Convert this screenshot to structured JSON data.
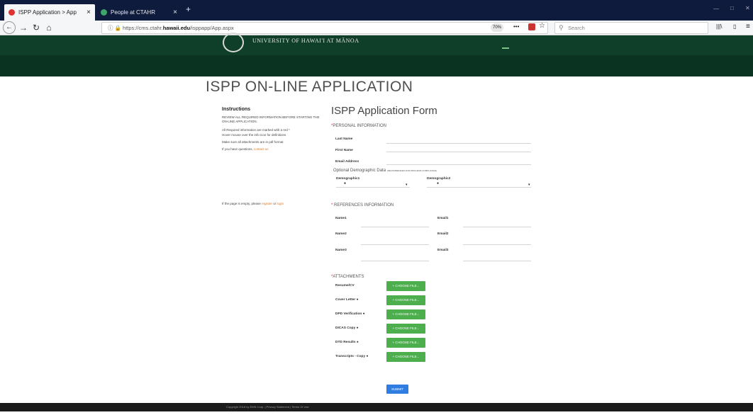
{
  "browser": {
    "tabs": [
      {
        "title": "ISPP Application > App",
        "close": "×"
      },
      {
        "title": "People at CTAHR",
        "close": "×"
      }
    ],
    "new_tab": "+",
    "url_prefix": "https://cms.ctahr.",
    "url_domain": "hawaii.edu",
    "url_path": "/isppapp/App.aspx",
    "zoom": "70%",
    "menu_dots": "•••",
    "search_placeholder": "Search",
    "window_min": "—",
    "window_max": "□",
    "window_close": "✕"
  },
  "site": {
    "university": "UNIVERSITY OF HAWAI'I AT MĀNOA"
  },
  "page": {
    "title": "ISPP ON-LINE APPLICATION",
    "instructions": {
      "heading": "Instructions",
      "line1": "REVIEW ALL REQUIRED INFORMATION BEFORE STARTING THE ON-LINE APPLICATION.",
      "line2": "All Required information are marked with a red *",
      "line3": "Hover mouse over the info icon for definitions",
      "line4": "Make sure all attachments are in pdf format",
      "line5": "If you have questions,",
      "contact": "contact us",
      "empty_note": "If the page is empty, please",
      "register": "register",
      "or": "or",
      "login": "login"
    },
    "form_title": "ISPP Application Form",
    "personal": {
      "section": "PERSONAL INFORMATION",
      "last_name": "Last Name",
      "first_name": "First Name",
      "email": "Email Address",
      "optional": "Optional Demographic Data",
      "optional_note": "(RECOMMENDED FOR PROGRAM COMPLIANCE)",
      "demo1": "Demographic1",
      "demo2": "Demographic2"
    },
    "references": {
      "section": "REFERENCES INFORMATION",
      "name1": "Name1",
      "email1": "Email1",
      "name2": "Name2",
      "email2": "Email2",
      "name3": "Name3",
      "email3": "Email3"
    },
    "attachments": {
      "section": "ATTACHMENTS",
      "items": [
        "Resume/CV",
        "Cover Letter",
        "DPD Verification",
        "DICAS Copy",
        "DTD Results",
        "Transcripts - Copy"
      ],
      "button": "+ CHOOSE FILE..."
    },
    "submit": "SUBMIT"
  },
  "footer": {
    "text": "Copyright 2018 by EMN Corp.  |  Privacy Statement  |  Terms Of Use"
  },
  "colors": {
    "header_green": "#0f3f28",
    "button_green": "#4cae4c",
    "submit_blue": "#2f7de1",
    "tab_bar": "#0f1b3d"
  }
}
